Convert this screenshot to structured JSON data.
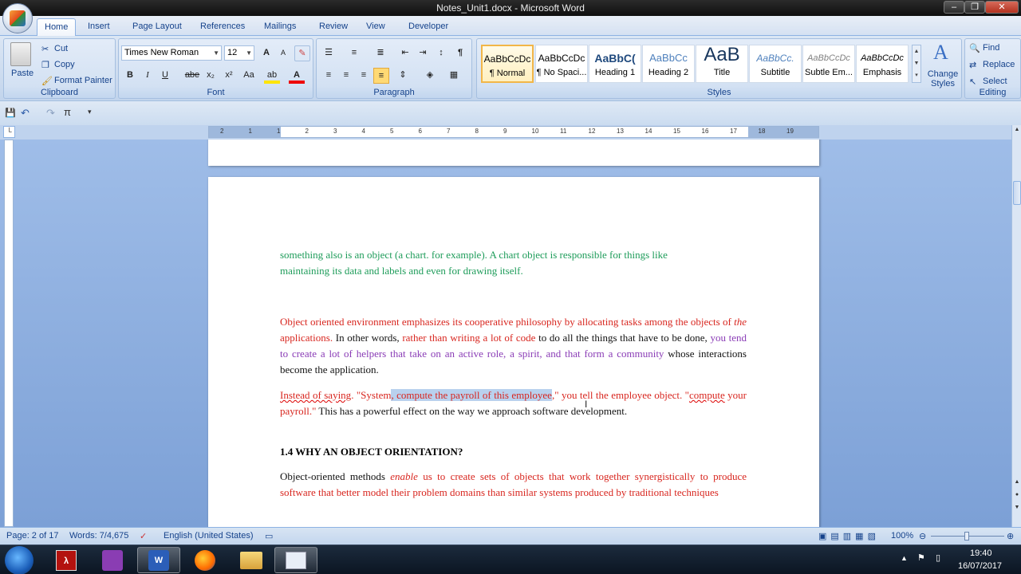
{
  "window": {
    "title": "Notes_Unit1.docx - Microsoft Word",
    "controls": [
      "–",
      "❐",
      "✕"
    ]
  },
  "tabs": [
    "Home",
    "Insert",
    "Page Layout",
    "References",
    "Mailings",
    "Review",
    "View",
    "Developer"
  ],
  "ribbon": {
    "clipboard": {
      "label": "Clipboard",
      "paste": "Paste",
      "cut": "Cut",
      "copy": "Copy",
      "format_painter": "Format Painter"
    },
    "font": {
      "label": "Font",
      "font_name": "Times New Roman",
      "font_size": "12",
      "bold": "B",
      "italic": "I",
      "underline": "U",
      "strike": "abe",
      "subscript": "x₂",
      "superscript": "x²",
      "change_case": "Aa",
      "grow": "A",
      "shrink": "A"
    },
    "paragraph": {
      "label": "Paragraph",
      "pilcrow": "¶"
    },
    "styles": {
      "label": "Styles",
      "items": [
        {
          "sample": "AaBbCcDc",
          "name": "¶ Normal"
        },
        {
          "sample": "AaBbCcDc",
          "name": "¶ No Spaci..."
        },
        {
          "sample": "AaBbC(",
          "name": "Heading 1"
        },
        {
          "sample": "AaBbCc",
          "name": "Heading 2"
        },
        {
          "sample": "AaB",
          "name": "Title"
        },
        {
          "sample": "AaBbCc.",
          "name": "Subtitle"
        },
        {
          "sample": "AaBbCcDc",
          "name": "Subtle Em..."
        },
        {
          "sample": "AaBbCcDc",
          "name": "Emphasis"
        }
      ],
      "change_styles": "Change Styles"
    },
    "editing": {
      "label": "Editing",
      "find": "Find",
      "replace": "Replace",
      "select": "Select"
    }
  },
  "ruler": {
    "labels": [
      "2",
      "1",
      "1",
      "2",
      "3",
      "4",
      "5",
      "6",
      "7",
      "8",
      "9",
      "10",
      "11",
      "12",
      "13",
      "14",
      "15",
      "16",
      "17",
      "18",
      "19"
    ]
  },
  "document": {
    "p1a": "something also is an object (a chart. for example). A chart object is responsible for things like",
    "p1b": "maintaining its data and labels and even for drawing itself.",
    "p2": {
      "s1": "Object oriented environment emphasizes its cooperative philosophy by allocating tasks among the objects of ",
      "s2": "the",
      "s3": " applications.",
      "s4": " In other words, ",
      "s5": "rather than writing a lot of code",
      "s6": " to do all the things that have to be done, ",
      "s7": "you tend to create a lot of helpers that take on an active role, a spirit, and that form a community",
      "s8": " whose interactions become the application."
    },
    "p3": {
      "s1": "Instead of saying",
      "s2": ". \"System",
      "s3": ", compute the payroll of this employee",
      "s4": ",\" you tell the employee object. \"",
      "s5": "compute",
      "s6": " your payroll.\"",
      "s7": " This has a powerful effect on the way we approach software development."
    },
    "heading": "1.4 WHY AN OBJECT ORIENTATION?",
    "p4": {
      "s1": "Object-oriented methods ",
      "s2": "enable",
      "s3": " us to create sets of objects that work together synergistically to produce software that better model their problem domains than similar systems produced by traditional techniques"
    }
  },
  "status": {
    "page": "Page: 2 of 17",
    "words": "Words: 7/4,675",
    "language": "English (United States)",
    "zoom": "100%"
  },
  "taskbar": {
    "time": "19:40",
    "date": "16/07/2017"
  }
}
